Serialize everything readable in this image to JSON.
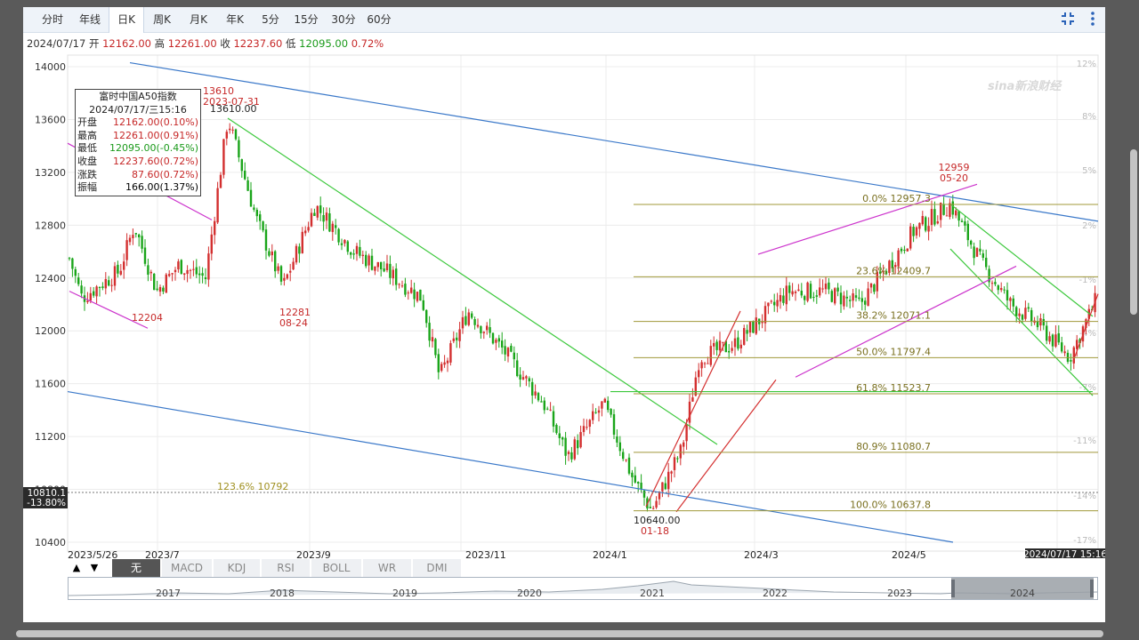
{
  "toolbar": {
    "tabs": [
      "分时",
      "年线",
      "日K",
      "周K",
      "月K",
      "年K",
      "5分",
      "15分",
      "30分",
      "60分"
    ],
    "active_tab": "日K"
  },
  "quote": {
    "date": "2024/07/17",
    "open_label": "开",
    "open": "12162.00",
    "high_label": "高",
    "high": "12261.00",
    "close_label": "收",
    "close": "12237.60",
    "low_label": "低",
    "low": "12095.00",
    "change": "0.72%"
  },
  "tooltip": {
    "name": "富时中国A50指数",
    "datetime": "2024/07/17/三15:16",
    "rows": [
      {
        "k": "开盘",
        "v": "12162.00(0.10%)",
        "color": "#c62828"
      },
      {
        "k": "最高",
        "v": "12261.00(0.91%)",
        "color": "#c62828"
      },
      {
        "k": "最低",
        "v": "12095.00(-0.45%)",
        "color": "#1a9a1a"
      },
      {
        "k": "收盘",
        "v": "12237.60(0.72%)",
        "color": "#c62828"
      },
      {
        "k": "涨跌",
        "v": "87.60(0.72%)",
        "color": "#c62828"
      },
      {
        "k": "振幅",
        "v": "166.00(1.37%)",
        "color": "#222"
      }
    ]
  },
  "chart_data": {
    "type": "candlestick",
    "y_ticks": [
      14000,
      13600,
      13200,
      12800,
      12400,
      12000,
      11600,
      11200,
      10800,
      10400
    ],
    "pct_ticks": [
      "12%",
      "8%",
      "5%",
      "2%",
      "-1%",
      "-4%",
      "-7%",
      "-11%",
      "-14%",
      "-17%"
    ],
    "x_ticks": [
      "2023/5/26",
      "2023/7",
      "2023/9",
      "2023/11",
      "2024/1",
      "2024/3",
      "2024/5"
    ],
    "crosshair": {
      "value": "10810.1",
      "pct": "-13.80%",
      "date": "2024/07/17 15:16"
    },
    "fib_levels": [
      {
        "label": "0.0% 12957.3",
        "value": 12957.3
      },
      {
        "label": "23.6% 12409.7",
        "value": 12409.7
      },
      {
        "label": "38.2% 12071.1",
        "value": 12071.1
      },
      {
        "label": "50.0% 11797.4",
        "value": 11797.4
      },
      {
        "label": "61.8% 11523.7",
        "value": 11523.7
      },
      {
        "label": "80.9% 11080.7",
        "value": 11080.7
      },
      {
        "label": "100.0% 10637.8",
        "value": 10637.8
      }
    ],
    "fib_extra": {
      "label": "123.6% 10792"
    },
    "annotations": [
      {
        "id": "high-2023",
        "lines": [
          "13610",
          "2023-07-31"
        ]
      },
      {
        "id": "high-2023-value",
        "lines": [
          "13610.00"
        ]
      },
      {
        "id": "low-1",
        "lines": [
          "12204"
        ]
      },
      {
        "id": "low-2",
        "lines": [
          "12281",
          "08-24"
        ]
      },
      {
        "id": "low-2024",
        "lines": [
          "10640.00",
          "01-18"
        ]
      },
      {
        "id": "high-2024",
        "lines": [
          "12959",
          "05-20"
        ]
      }
    ],
    "watermark": "sina新浪财经",
    "colors": {
      "up": "#d32f2f",
      "down": "#1aa51a",
      "channel_blue": "#3a78c9",
      "trend_green": "#3cc83c",
      "channel_magenta": "#cc33cc",
      "channel_red": "#d43030",
      "fib": "#a0983a"
    },
    "grid": true
  },
  "indicators": {
    "up_arrow": "▲",
    "down_arrow": "▼",
    "items": [
      "无",
      "MACD",
      "KDJ",
      "RSI",
      "BOLL",
      "WR",
      "DMI"
    ],
    "active": "无"
  },
  "overview": {
    "years": [
      "2017",
      "2018",
      "2019",
      "2020",
      "2021",
      "2022",
      "2023",
      "2024"
    ]
  }
}
